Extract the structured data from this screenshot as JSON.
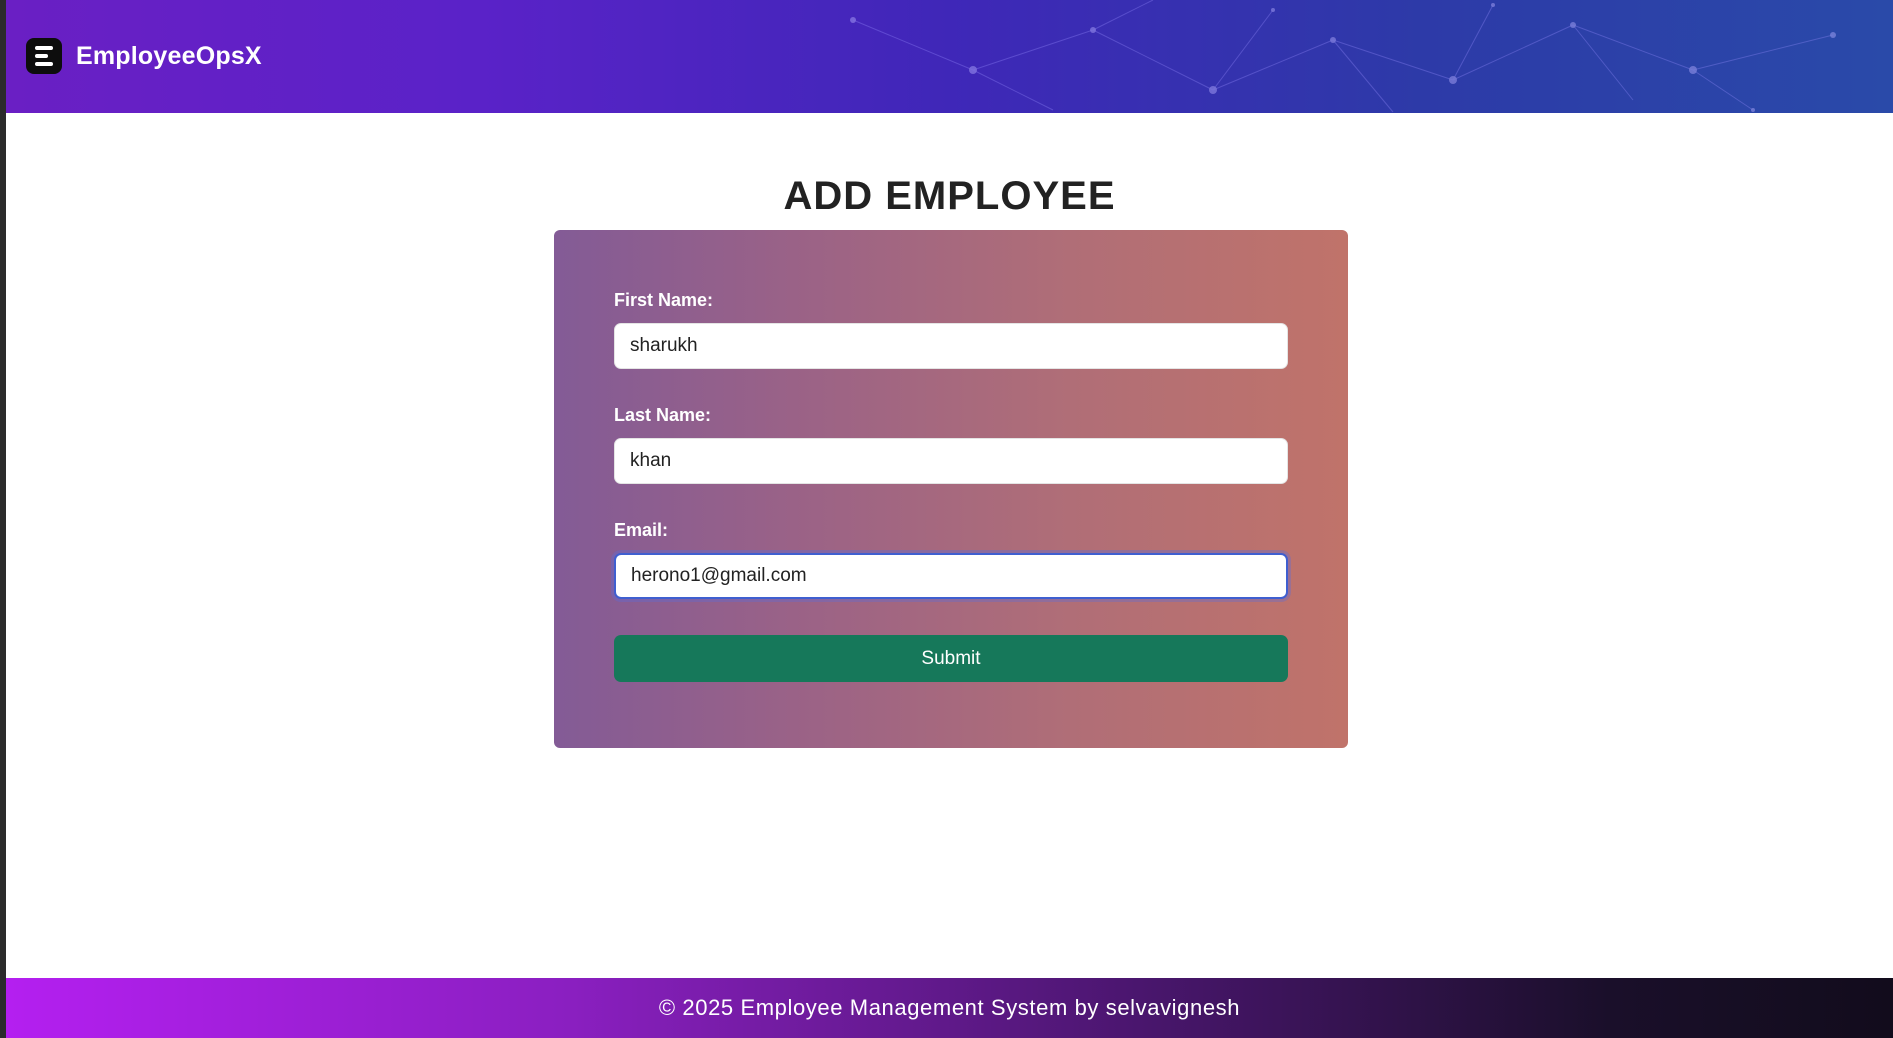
{
  "navbar": {
    "brand_name": "EmployeeOpsX",
    "brand_icon": "menu-lines-icon"
  },
  "page": {
    "title": "ADD EMPLOYEE"
  },
  "form": {
    "first_name": {
      "label": "First Name:",
      "value": "sharukh"
    },
    "last_name": {
      "label": "Last Name:",
      "value": "khan"
    },
    "email": {
      "label": "Email:",
      "value": "herono1@gmail.com"
    },
    "submit_label": "Submit"
  },
  "footer": {
    "text": "© 2025 Employee Management System by selvavignesh"
  },
  "colors": {
    "submit_button": "#16785a",
    "navbar_start": "#6a1fc4",
    "navbar_end": "#2a4aa9",
    "card_start": "#835b96",
    "card_end": "#c0736a"
  }
}
